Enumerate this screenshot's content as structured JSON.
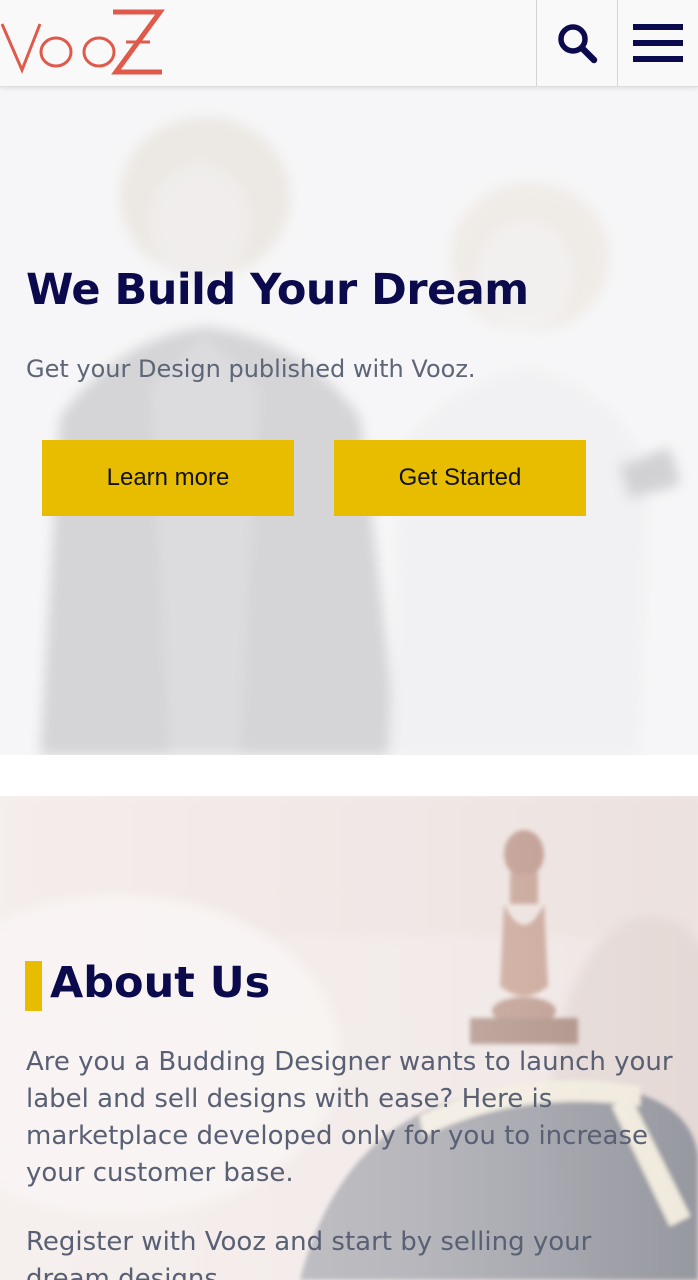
{
  "header": {
    "logo_text": "VooZ",
    "brand_color": "#e05a4c",
    "search_icon": "search-icon",
    "menu_icon": "hamburger-menu-icon"
  },
  "hero": {
    "title": "We Build Your Dream",
    "subtitle": "Get your Design published with Vooz.",
    "learn_more_label": "Learn more",
    "get_started_label": "Get Started",
    "button_color": "#e8bd00",
    "title_color": "#0a0a4d"
  },
  "about": {
    "title": "About Us",
    "paragraph_1": "Are you a Budding Designer wants to launch your label and sell designs with ease? Here is marketplace developed only for you to increase your customer base.",
    "paragraph_2": "Register with Vooz and start by selling your dream designs"
  }
}
